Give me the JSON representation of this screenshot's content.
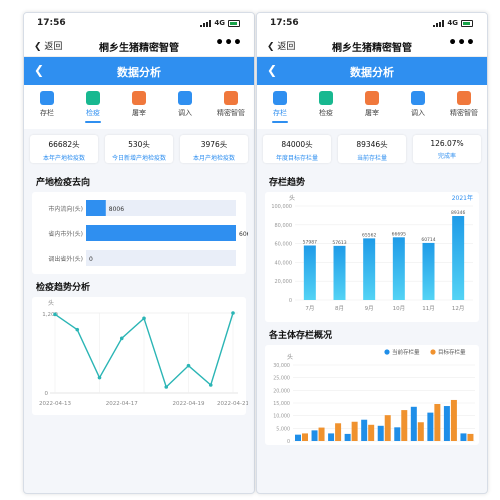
{
  "status": {
    "time": "17:56",
    "network": "4G"
  },
  "appbar": {
    "back_label": "返回",
    "title": "桐乡生猪精密智管",
    "more": "•••"
  },
  "bluebar": {
    "title": "数据分析"
  },
  "tabs": [
    {
      "label": "存栏",
      "icon": "layers-icon",
      "color": "#2f8ff0"
    },
    {
      "label": "检疫",
      "icon": "chart-icon",
      "color": "#18b890"
    },
    {
      "label": "屠宰",
      "icon": "pig-icon",
      "color": "#f0783c"
    },
    {
      "label": "调入",
      "icon": "check-list-icon",
      "color": "#2f8ff0"
    },
    {
      "label": "精密智管",
      "icon": "trend-icon",
      "color": "#f0783c"
    }
  ],
  "left": {
    "stats": [
      {
        "value": "66682头",
        "label": "本年产地检疫数"
      },
      {
        "value": "530头",
        "label": "今日新增产地检疫数"
      },
      {
        "value": "3976头",
        "label": "本月产地检疫数"
      }
    ],
    "section1": "产地检疫去向",
    "hbar": {
      "rows": [
        {
          "label": "市内流向(头)",
          "value": 8006,
          "display": "8006"
        },
        {
          "label": "省内市外(头)",
          "value": 60687,
          "display": "60687"
        },
        {
          "label": "调出省外(头)",
          "value": 0,
          "display": "0"
        }
      ]
    },
    "section2": "检疫趋势分析",
    "chart_data": {
      "type": "line",
      "ylabel": "头",
      "ylim": [
        0,
        1200
      ],
      "yticks": [
        "1,200",
        "0"
      ],
      "xticks": [
        "2022-04-13",
        "2022-04-17",
        "2022-04-19",
        "2022-04-21"
      ],
      "values": [
        1180,
        950,
        230,
        820,
        1120,
        90,
        410,
        120,
        1200
      ],
      "color": "#2bb5b5"
    }
  },
  "right": {
    "stats": [
      {
        "value": "84000头",
        "label": "年度目标存栏量"
      },
      {
        "value": "89346头",
        "label": "当前存栏量"
      },
      {
        "value": "126.07%",
        "label": "完成率"
      }
    ],
    "section1": "存栏趋势",
    "bar_chart": {
      "type": "bar",
      "ylabel": "头",
      "year": "2021年",
      "ylim": [
        0,
        100000
      ],
      "yticks": [
        "100,000",
        "80,000",
        "60,000",
        "40,000",
        "20,000",
        "0"
      ],
      "categories": [
        "7月",
        "8月",
        "9月",
        "10月",
        "11月",
        "12月"
      ],
      "values": [
        57987,
        57613,
        65562,
        66695,
        60714,
        89346
      ],
      "labels": [
        "57987",
        "57613",
        "65562",
        "66695",
        "60714",
        "89346"
      ]
    },
    "section2": "各主体存栏概况",
    "group_chart": {
      "type": "bar",
      "ylabel": "头",
      "ylim": [
        0,
        30000
      ],
      "yticks": [
        "30,000",
        "25,000",
        "20,000",
        "15,000",
        "10,000",
        "5,000",
        "0"
      ],
      "legend": [
        {
          "name": "当前存栏量",
          "color": "#1f8ee8"
        },
        {
          "name": "目标存栏量",
          "color": "#f0922e"
        }
      ],
      "series_current": [
        2500,
        4200,
        3000,
        2800,
        8400,
        6000,
        5400,
        13500,
        11200,
        13800,
        3000
      ],
      "series_target": [
        3000,
        5300,
        7000,
        7600,
        6400,
        10200,
        12200,
        7400,
        14600,
        16200,
        2800
      ]
    }
  }
}
